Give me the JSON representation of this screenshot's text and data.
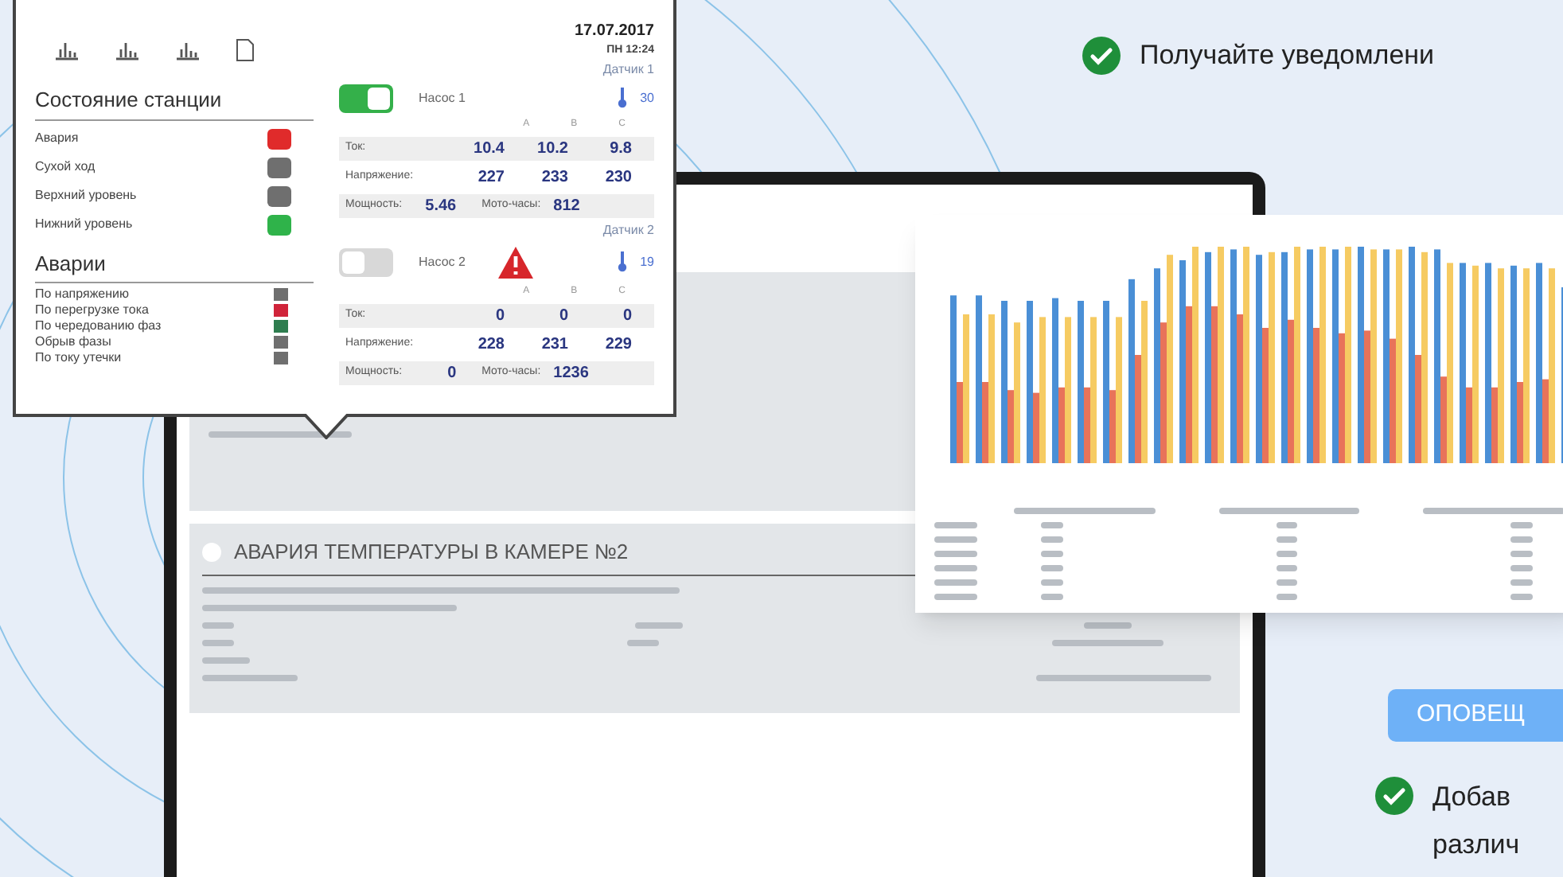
{
  "popup": {
    "date": "17.07.2017",
    "time": "ПН 12:24",
    "station_title": "Состояние станции",
    "station_states": [
      {
        "label": "Авария",
        "color": "#e02b2b"
      },
      {
        "label": "Сухой ход",
        "color": "#6f6f6f"
      },
      {
        "label": "Верхний уровень",
        "color": "#6f6f6f"
      },
      {
        "label": "Нижний уровень",
        "color": "#2fb34a"
      }
    ],
    "alarms_title": "Аварии",
    "alarms": [
      {
        "label": "По напряжению",
        "color": "#6f6f6f"
      },
      {
        "label": "По перегрузке тока",
        "color": "#d0243a"
      },
      {
        "label": "По чередованию фаз",
        "color": "#2e7d4f"
      },
      {
        "label": "Обрыв фазы",
        "color": "#6f6f6f"
      },
      {
        "label": "По току утечки",
        "color": "#6f6f6f"
      }
    ],
    "pumps": [
      {
        "sensor": "Датчик 1",
        "temperature": "30",
        "name": "Насос 1",
        "on": true,
        "alarm": false,
        "phases": [
          "A",
          "B",
          "C"
        ],
        "rows": [
          {
            "label": "Ток:",
            "values": [
              "10.4",
              "10.2",
              "9.8"
            ]
          },
          {
            "label": "Напряжение:",
            "values": [
              "227",
              "233",
              "230"
            ]
          }
        ],
        "power_label": "Мощность:",
        "power": "5.46",
        "hours_label": "Мото-часы:",
        "hours": "812"
      },
      {
        "sensor": "Датчик 2",
        "temperature": "19",
        "name": "Насос 2",
        "on": false,
        "alarm": true,
        "phases": [
          "A",
          "B",
          "C"
        ],
        "rows": [
          {
            "label": "Ток:",
            "values": [
              "0",
              "0",
              "0"
            ]
          },
          {
            "label": "Напряжение:",
            "values": [
              "228",
              "231",
              "229"
            ]
          }
        ],
        "power_label": "Мощность:",
        "power": "0",
        "hours_label": "Мото-часы:",
        "hours": "1236"
      }
    ]
  },
  "laptop": {
    "checked": false,
    "section_title": "АВАРИЯ ТЕМПЕРАТУРЫ В КАМЕРЕ №2"
  },
  "feature_top": "Получайте уведомлени",
  "notify_button": "ОПОВЕЩ",
  "feature_bottom": [
    "Добав",
    "различ"
  ]
}
